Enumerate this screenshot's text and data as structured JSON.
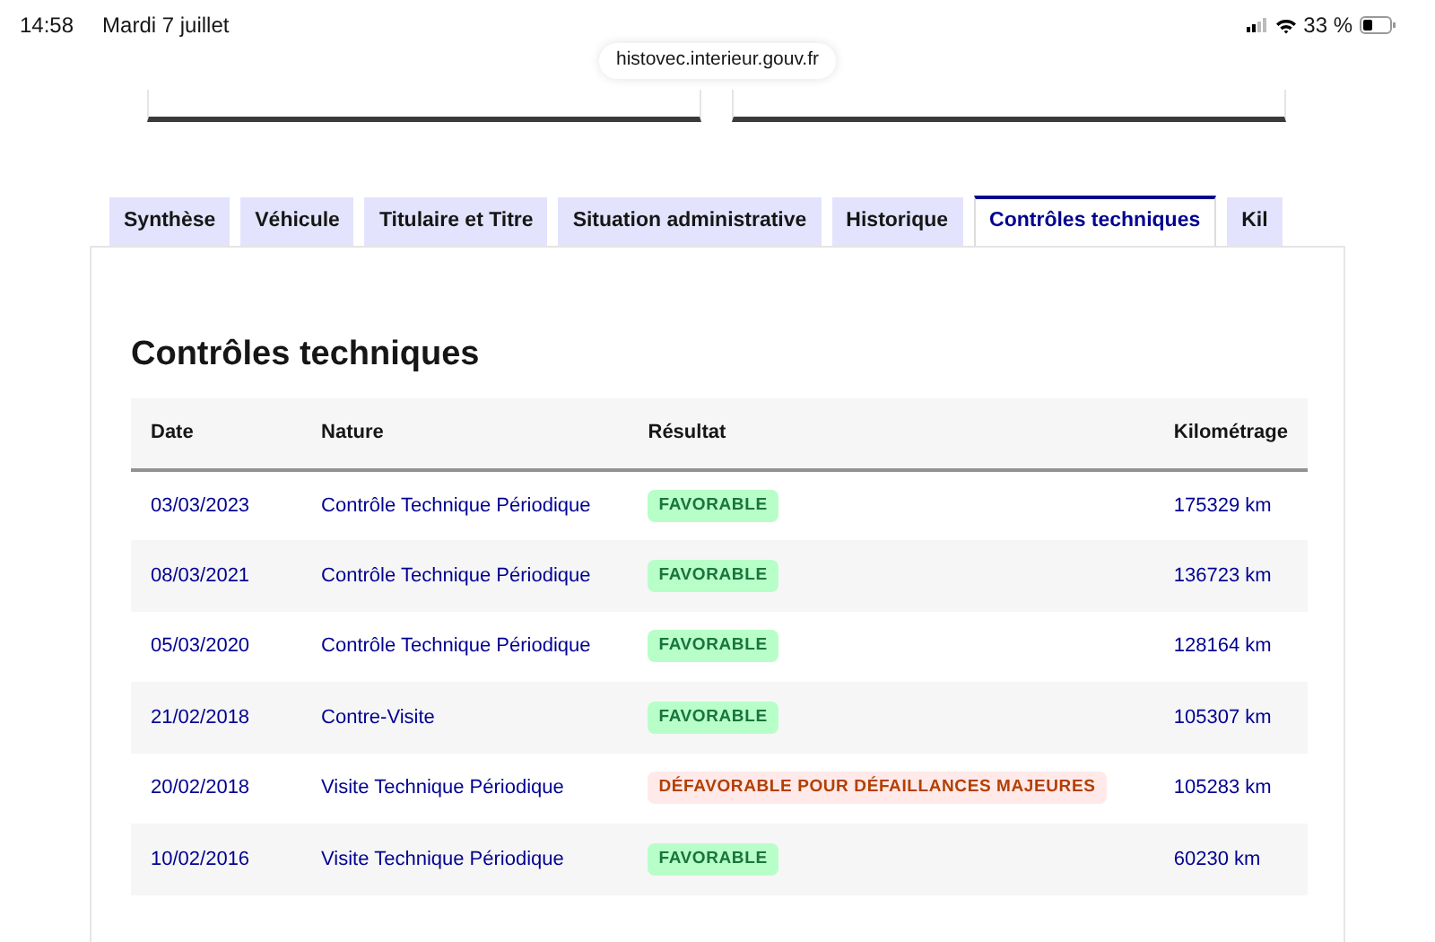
{
  "status_bar": {
    "time": "14:58",
    "date": "Mardi 7 juillet",
    "battery": "33 %"
  },
  "address_bar": {
    "url": "histovec.interieur.gouv.fr"
  },
  "tabs": [
    {
      "label": "Synthèse",
      "selected": false
    },
    {
      "label": "Véhicule",
      "selected": false
    },
    {
      "label": "Titulaire et Titre",
      "selected": false
    },
    {
      "label": "Situation administrative",
      "selected": false
    },
    {
      "label": "Historique",
      "selected": false
    },
    {
      "label": "Contrôles techniques",
      "selected": true
    },
    {
      "label": "Kil",
      "selected": false
    }
  ],
  "section": {
    "title": "Contrôles techniques"
  },
  "table": {
    "columns": [
      "Date",
      "Nature",
      "Résultat",
      "Kilométrage"
    ],
    "rows": [
      {
        "date": "03/03/2023",
        "nature": "Contrôle Technique Périodique",
        "result": {
          "label": "FAVORABLE",
          "kind": "favorable"
        },
        "mileage": "175329 km"
      },
      {
        "date": "08/03/2021",
        "nature": "Contrôle Technique Périodique",
        "result": {
          "label": "FAVORABLE",
          "kind": "favorable"
        },
        "mileage": "136723 km"
      },
      {
        "date": "05/03/2020",
        "nature": "Contrôle Technique Périodique",
        "result": {
          "label": "FAVORABLE",
          "kind": "favorable"
        },
        "mileage": "128164 km"
      },
      {
        "date": "21/02/2018",
        "nature": "Contre-Visite",
        "result": {
          "label": "FAVORABLE",
          "kind": "favorable"
        },
        "mileage": "105307 km"
      },
      {
        "date": "20/02/2018",
        "nature": "Visite Technique Périodique",
        "result": {
          "label": "DÉFAVORABLE POUR DÉFAILLANCES MAJEURES",
          "kind": "unfavorable"
        },
        "mileage": "105283 km"
      },
      {
        "date": "10/02/2016",
        "nature": "Visite Technique Périodique",
        "result": {
          "label": "FAVORABLE",
          "kind": "favorable"
        },
        "mileage": "60230 km"
      }
    ]
  }
}
